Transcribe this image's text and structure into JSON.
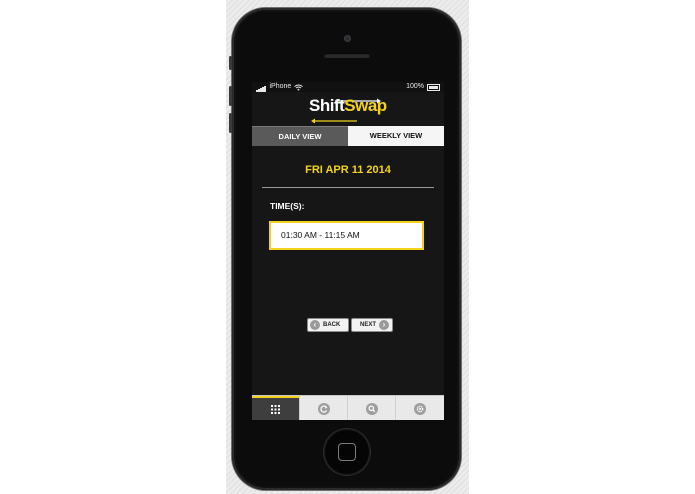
{
  "status_bar": {
    "carrier": "iPhone",
    "battery": "100%"
  },
  "logo": {
    "part1": "Shift",
    "part2": "Swap"
  },
  "tabs": [
    {
      "label": "DAILY VIEW",
      "active": true
    },
    {
      "label": "WEEKLY VIEW",
      "active": false
    }
  ],
  "date_header": "FRI APR 11 2014",
  "times": {
    "label": "TIME(S):",
    "value": "01:30 AM - 11:15 AM"
  },
  "nav": {
    "back": "BACK",
    "next": "NEXT"
  },
  "tabbar": [
    {
      "icon": "grid-icon",
      "active": true
    },
    {
      "icon": "refresh-icon",
      "active": false
    },
    {
      "icon": "search-icon",
      "active": false
    },
    {
      "icon": "settings-icon",
      "active": false
    }
  ],
  "colors": {
    "accent": "#f2d21b",
    "background": "#161616"
  }
}
